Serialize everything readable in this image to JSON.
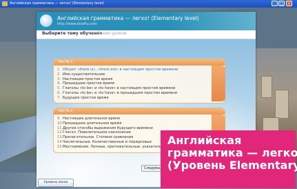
{
  "window": {
    "title": "Английская грамматика — легко! (Elementary level)"
  },
  "app": {
    "title": "Английская грамматика — легко! (Elementary level)",
    "subtitle": "http://www.bisoftu.com"
  },
  "topic": {
    "label": "Выберите тему обучения",
    "arrow": "→",
    "hint": "Линия уроков"
  },
  "part1": {
    "title": "ЧАСТЬ 1",
    "items": [
      {
        "num": "1.",
        "label": "Оборот «there is», «there are» в настоящем простом времени"
      },
      {
        "num": "2.",
        "label": "Имя существительное"
      },
      {
        "num": "3.",
        "label": "Настоящее простое время"
      },
      {
        "num": "4.",
        "label": "Прошедшее простое время"
      },
      {
        "num": "5.",
        "label": "Глаголы «to be» и «to have» в настоящем простом времени"
      },
      {
        "num": "6.",
        "label": "Глаголы «to be» и «to have» в прошедшем простом времени"
      },
      {
        "num": "7.",
        "label": "Будущее простое время"
      }
    ]
  },
  "part2": {
    "title": "ЧАСТЬ 2",
    "items": [
      {
        "num": "9.",
        "label": "Настоящее длительное время"
      },
      {
        "num": "10.",
        "label": "Прошедшее длительное время"
      },
      {
        "num": "11.",
        "label": "Другие способы выражения будущего времени"
      },
      {
        "num": "12.",
        "label": "Глагол. Повелительное наклонение"
      },
      {
        "num": "13.",
        "label": "Прилагательное. Степени сравнения"
      },
      {
        "num": "14.",
        "label": "Числительные. Количественные и порядковые"
      },
      {
        "num": "15.",
        "label": "Местоимения. Личные, притяжательные, указательные"
      }
    ]
  },
  "buttons": {
    "next": "Следующ",
    "level": "Уровень меню"
  },
  "caption": {
    "line1": "Английская",
    "line2": "грамматика — легко!",
    "line3": "(Уровень Elementary)"
  }
}
